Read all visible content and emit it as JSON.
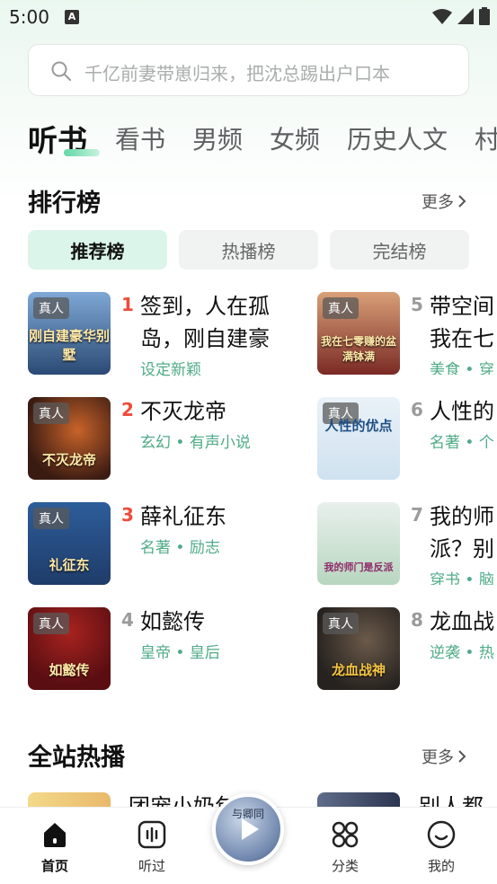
{
  "status_bar": {
    "time": "5:00",
    "notification_letter": "A"
  },
  "search": {
    "placeholder": "千亿前妻带崽归来，把沈总踢出户口本"
  },
  "category_tabs": [
    {
      "label": "听书",
      "active": true
    },
    {
      "label": "看书",
      "active": false
    },
    {
      "label": "男频",
      "active": false
    },
    {
      "label": "女频",
      "active": false
    },
    {
      "label": "历史人文",
      "active": false
    },
    {
      "label": "村",
      "active": false
    }
  ],
  "ranking": {
    "title": "排行榜",
    "more_label": "更多",
    "tabs": [
      {
        "label": "推荐榜",
        "active": true
      },
      {
        "label": "热播榜",
        "active": false
      },
      {
        "label": "完结榜",
        "active": false
      }
    ],
    "badge_label": "真人",
    "books": [
      {
        "rank": "1",
        "title": "签到，人在孤岛，刚自建豪",
        "tags": "设定新颖",
        "cover_text": "刚自建豪华别墅",
        "cover_color": "#2a4a74"
      },
      {
        "rank": "2",
        "title": "不灭龙帝",
        "tags": "玄幻 • 有声小说",
        "cover_text": "不灭龙帝",
        "cover_color": "#3a1b12"
      },
      {
        "rank": "3",
        "title": "薛礼征东",
        "tags": "名著 • 励志",
        "cover_text": "礼征东",
        "cover_color": "#1e3c69"
      },
      {
        "rank": "4",
        "title": "如懿传",
        "tags": "皇帝 • 皇后",
        "cover_text": "如懿传",
        "cover_color": "#5a0e12"
      },
      {
        "rank": "5",
        "title": "带空间我在七",
        "tags": "美食 • 穿",
        "cover_text": "我在七零赚的盆满钵满",
        "cover_color": "#7a2a25"
      },
      {
        "rank": "6",
        "title": "人性的",
        "tags": "名著 • 个",
        "cover_text": "人性的优点",
        "cover_color": "#cfe1ef"
      },
      {
        "rank": "7",
        "title": "我的师派？别",
        "tags": "穿书 • 脑",
        "cover_text": "我的师门是反派",
        "cover_color": "#b8d6c0"
      },
      {
        "rank": "8",
        "title": "龙血战",
        "tags": "逆袭 • 热",
        "cover_text": "龙血战神",
        "cover_color": "#26221f"
      }
    ]
  },
  "hot": {
    "title": "全站热播",
    "more_label": "更多",
    "peek_titles": [
      "团宠小奶包",
      "别人都有"
    ]
  },
  "bottom_nav": {
    "items": [
      {
        "label": "首页",
        "icon": "home-icon",
        "active": true
      },
      {
        "label": "听过",
        "icon": "audio-wave-icon",
        "active": false
      },
      {
        "label": "分类",
        "icon": "category-grid-icon",
        "active": false
      },
      {
        "label": "我的",
        "icon": "profile-smile-icon",
        "active": false
      }
    ],
    "player_cover_text": "与卿同"
  },
  "colors": {
    "accent_green": "#4fab88",
    "rank_hot": "#ef4b3a",
    "active_tab_bg": "#dcf5ea"
  }
}
